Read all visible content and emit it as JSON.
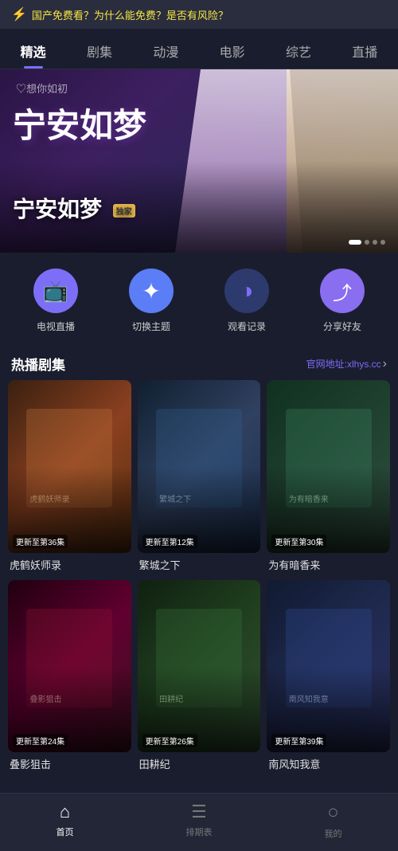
{
  "topBanner": {
    "text": "国产免费看？为什么能免费？是否有风险？"
  },
  "navTabs": [
    {
      "label": "精选",
      "active": true
    },
    {
      "label": "剧集",
      "active": false
    },
    {
      "label": "动漫",
      "active": false
    },
    {
      "label": "电影",
      "active": false
    },
    {
      "label": "综艺",
      "active": false
    },
    {
      "label": "直播",
      "active": false
    }
  ],
  "heroBanner": {
    "logoText": "♡想你如初",
    "dramatitle": "宁安如梦",
    "vipLabel": "独家",
    "subtitle": "宁安如梦"
  },
  "quickActions": [
    {
      "icon": "📺",
      "label": "电视直播",
      "bg": "purple-bg"
    },
    {
      "icon": "✦",
      "label": "切换主题",
      "bg": "blue-bg"
    },
    {
      "icon": "◑",
      "label": "观看记录",
      "bg": "dark-blue-bg"
    },
    {
      "icon": "↗",
      "label": "分享好友",
      "bg": "purple-light-bg"
    }
  ],
  "hotSection": {
    "title": "热播剧集",
    "linkLabel": "官网地址:xlhys.cc",
    "linkIcon": "›"
  },
  "dramaCards": [
    {
      "title": "虎鹤妖师录",
      "episode": "更新至第36集",
      "bgColor1": "#3a2010",
      "bgColor2": "#8a4020"
    },
    {
      "title": "繁城之下",
      "episode": "更新至第12集",
      "bgColor1": "#102030",
      "bgColor2": "#304060"
    },
    {
      "title": "为有暗香来",
      "episode": "更新至第30集",
      "bgColor1": "#103020",
      "bgColor2": "#204030"
    },
    {
      "title": "叠影狙击",
      "episode": "更新至第24集",
      "bgColor1": "#200010",
      "bgColor2": "#600030"
    },
    {
      "title": "田耕纪",
      "episode": "更新至第26集",
      "bgColor1": "#102010",
      "bgColor2": "#204020"
    },
    {
      "title": "南风知我意",
      "episode": "更新至第39集",
      "bgColor1": "#101a30",
      "bgColor2": "#202a50"
    }
  ],
  "bottomNav": [
    {
      "icon": "⌂",
      "label": "首页",
      "active": true
    },
    {
      "icon": "☰",
      "label": "排期表",
      "active": false
    },
    {
      "icon": "●",
      "label": "我的",
      "active": false
    }
  ]
}
